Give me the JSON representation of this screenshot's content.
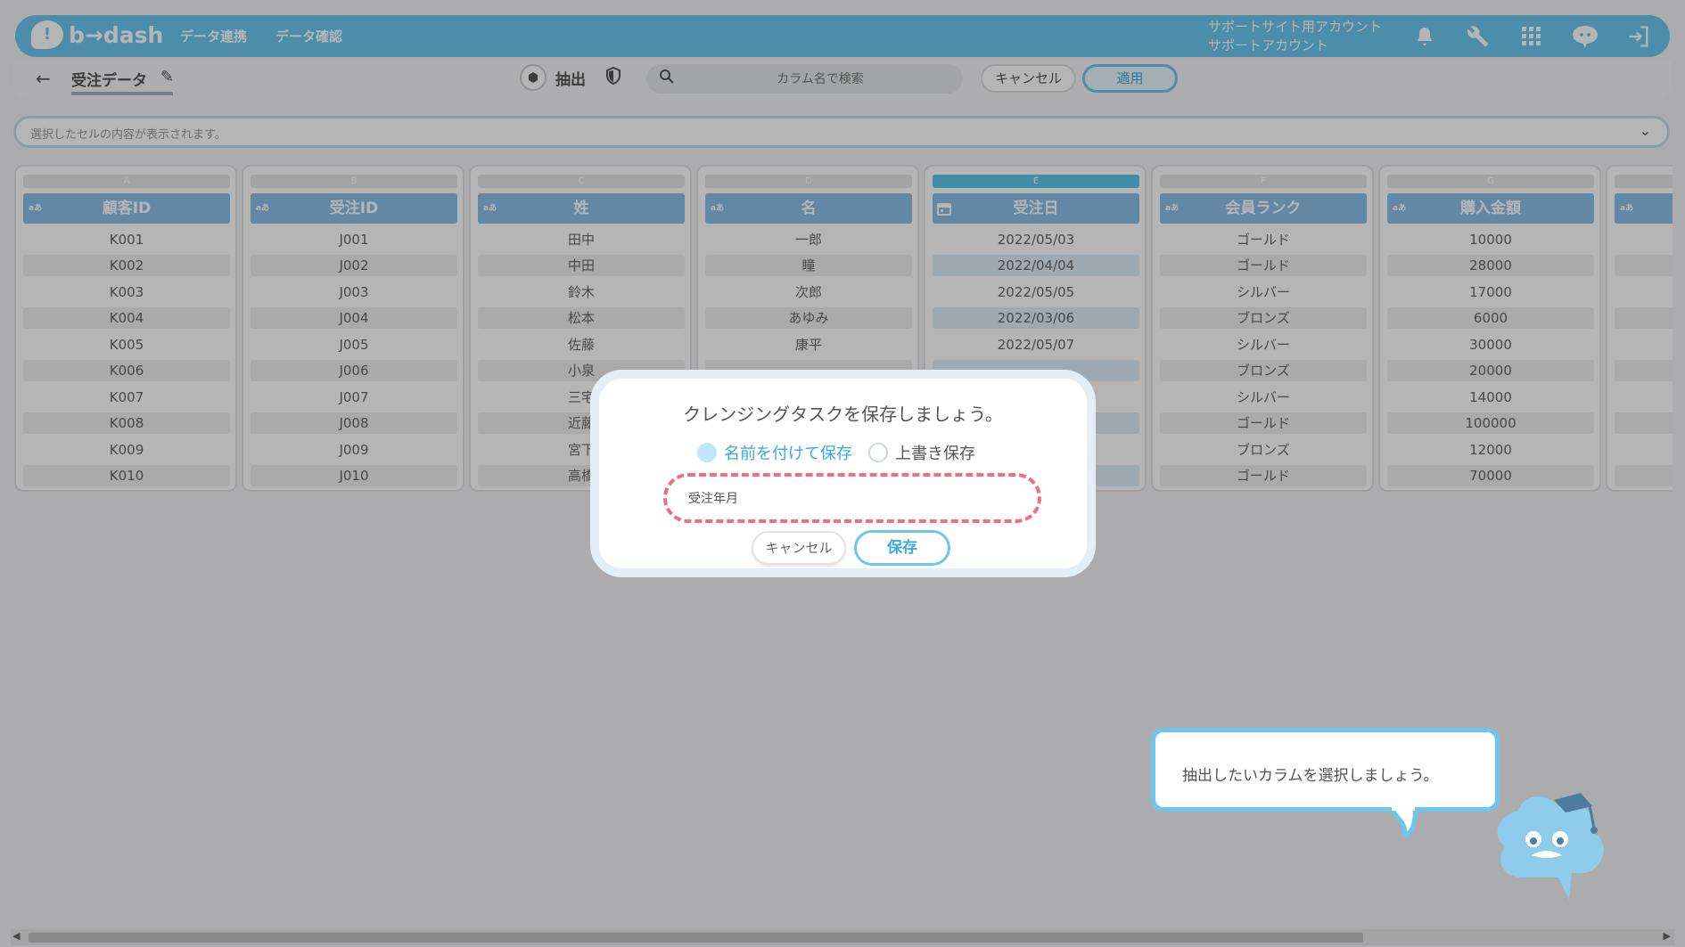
{
  "header": {
    "logo_mark": "!",
    "logo_text": "b→dash",
    "nav": [
      "データ連携",
      "データ確認"
    ],
    "account_line1": "サポートサイト用アカウント",
    "account_line2": "サポートアカウント",
    "icons": [
      "bell-icon",
      "wrench-icon",
      "grid-icon",
      "brain-icon",
      "logout-icon"
    ]
  },
  "toolbar": {
    "page_title": "受注データ",
    "extract_label": "抽出",
    "search_placeholder": "カラム名で検索",
    "cancel_label": "キャンセル",
    "apply_label": "適用"
  },
  "cell_bar": {
    "text": "選択したセルの内容が表示されます。"
  },
  "columns": [
    {
      "letter": "A",
      "type_tag": "aあ",
      "name": "顧客ID",
      "selected": false,
      "cells": [
        "K001",
        "K002",
        "K003",
        "K004",
        "K005",
        "K006",
        "K007",
        "K008",
        "K009",
        "K010"
      ]
    },
    {
      "letter": "B",
      "type_tag": "aあ",
      "name": "受注ID",
      "selected": false,
      "cells": [
        "J001",
        "J002",
        "J003",
        "J004",
        "J005",
        "J006",
        "J007",
        "J008",
        "J009",
        "J010"
      ]
    },
    {
      "letter": "C",
      "type_tag": "aあ",
      "name": "姓",
      "selected": false,
      "cells": [
        "田中",
        "中田",
        "鈴木",
        "松本",
        "佐藤",
        "小泉",
        "三宅",
        "近藤",
        "宮下",
        "高橋"
      ]
    },
    {
      "letter": "D",
      "type_tag": "aあ",
      "name": "名",
      "selected": false,
      "cells": [
        "一郎",
        "瞳",
        "次郎",
        "あゆみ",
        "康平",
        "",
        "",
        "",
        "",
        ""
      ]
    },
    {
      "letter": "E",
      "type_tag": "calendar",
      "name": "受注日",
      "selected": true,
      "cells": [
        "2022/05/03",
        "2022/04/04",
        "2022/05/05",
        "2022/03/06",
        "2022/05/07",
        "",
        "",
        "",
        "",
        ""
      ]
    },
    {
      "letter": "F",
      "type_tag": "aあ",
      "name": "会員ランク",
      "selected": false,
      "cells": [
        "ゴールド",
        "ゴールド",
        "シルバー",
        "ブロンズ",
        "シルバー",
        "ブロンズ",
        "シルバー",
        "ゴールド",
        "ブロンズ",
        "ゴールド"
      ]
    },
    {
      "letter": "G",
      "type_tag": "aあ",
      "name": "購入金額",
      "selected": false,
      "cells": [
        "10000",
        "28000",
        "17000",
        "6000",
        "30000",
        "20000",
        "14000",
        "100000",
        "12000",
        "70000"
      ]
    },
    {
      "letter": "H",
      "type_tag": "aあ",
      "name": "",
      "selected": false,
      "cells": [
        "",
        "",
        "",
        "",
        "",
        "",
        "",
        "",
        "",
        ""
      ]
    }
  ],
  "modal": {
    "title": "クレンジングタスクを保存しましょう。",
    "radio_new": "名前を付けて保存",
    "radio_overwrite": "上書き保存",
    "selected_option": "new",
    "name_value": "受注年月",
    "cancel_label": "キャンセル",
    "save_label": "保存"
  },
  "assistant": {
    "message": "抽出したいカラムを選択しましょう。"
  }
}
